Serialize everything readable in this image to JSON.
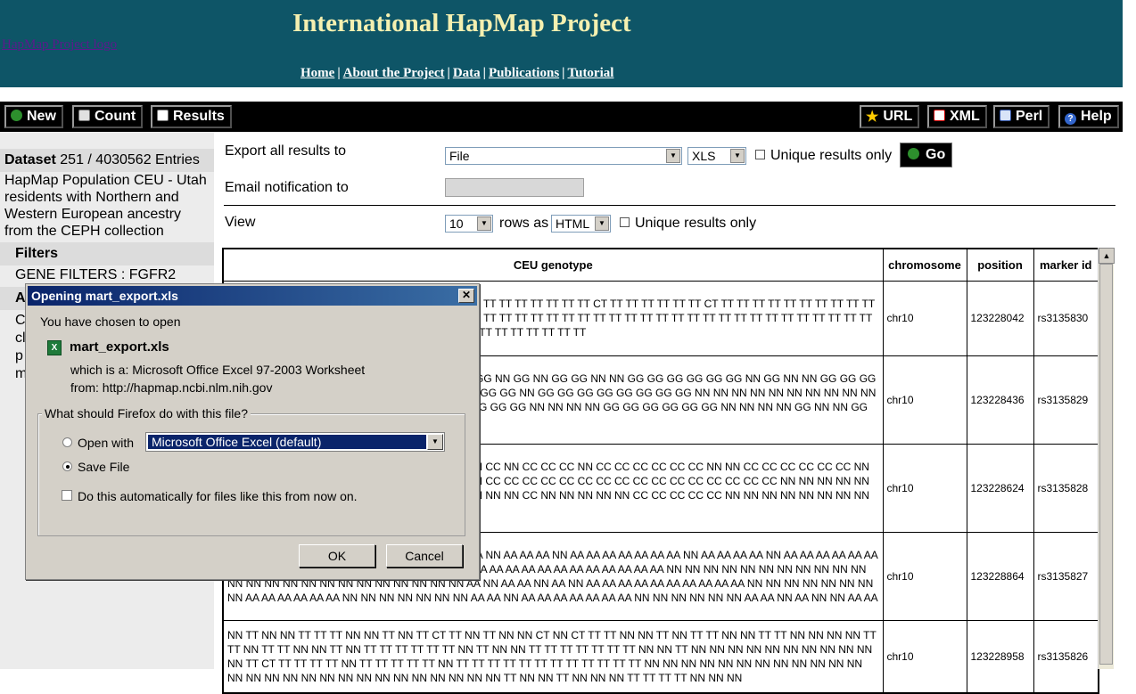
{
  "header": {
    "title": "International HapMap Project",
    "logo_alt": "HapMap Project logo",
    "nav": [
      "Home",
      "About the Project",
      "Data",
      "Publications",
      "Tutorial"
    ]
  },
  "toolbar": {
    "new": "New",
    "count": "Count",
    "results": "Results",
    "url": "URL",
    "xml": "XML",
    "perl": "Perl",
    "help": "Help"
  },
  "sidebar": {
    "dataset_label": "Dataset",
    "dataset_count": "251 / 4030562 Entries",
    "dataset_desc": "HapMap Population CEU - Utah residents with Northern and Western European ancestry from the CEPH collection",
    "filters_label": "Filters",
    "filter_value": "GENE FILTERS : FGFR2",
    "attributes_label": "A",
    "attr_fragments": [
      "C",
      "cl",
      "p",
      "m"
    ]
  },
  "export": {
    "label": "Export  all results to",
    "destination": "File",
    "format": "XLS",
    "unique_label": "Unique results only",
    "go": "Go",
    "email_label": "Email notification to",
    "email_value": ""
  },
  "view": {
    "label": "View",
    "rows": "10",
    "rows_as": "rows as",
    "format": "HTML",
    "unique_label": "Unique results only"
  },
  "table": {
    "headers": [
      "CEU genotype",
      "chromosome",
      "position",
      "marker id"
    ],
    "rows": [
      {
        "genotype": "NN TT NN TT TT TT TT TT TT TT TT TT TT TT TT TT TT TT TT TT TT TT TT CT TT TT TT TT TT TT CT TT TT TT TT TT TT TT TT TT TT TT TT CT TT TT TT TT TT TT CT TT NN TT TT TT TT TT TT TT TT TT TT TT TT TT TT TT TT TT TT TT TT TT TT TT TT TT TT TT TT TT CT TT TT TT TT TT TT TT TT TT TT TT TT TT TT TT TT TT TT TT TT TT TT",
        "chromosome": "chr10",
        "position": "123228042",
        "marker": "rs3135830"
      },
      {
        "genotype": "GG GG NN GG NN NN GG NN GG GG GG NN NN GG NN GG NN GG GG NN NN GG GG GG GG GG GG NN GG NN NN GG GG GG GG NN GG NN GG GG GG GG GG GG GG GG GG GG GG NN GG GG GG GG GG GG GG GG NN NN NN NN NN NN NN NN NN NN NN NN NN NN NN NN NN NN NN GG GG GG NN GG GG GG NN NN NN NN GG GG GG GG GG GG NN NN NN NN GG NN NN GG GG",
        "chromosome": "chr10",
        "position": "123228436",
        "marker": "rs3135829"
      },
      {
        "genotype": "CC NN CC NN NN CC NN CC CC CC NN NN CC NN CC NN CC CC CC NN CC CC CC CC CC CC NN NN CC CC CC CC CC CC NN CC CC CC CC NN CC CC CC CC CC CC CC CC NN CC CC CC CC CC CC CC CC CC CC CC CC CC CC CC CC NN NN NN NN NN NN NN NN NN NN NN NN NN NN NN NN NN NN NN NN NN CC NN NN NN NN NN CC CC CC CC CC NN NN NN NN NN NN NN NN NN CC CC CC",
        "chromosome": "chr10",
        "position": "123228624",
        "marker": "rs3135828"
      },
      {
        "genotype": "AA NN AA NN NN AA NN AA AA AA NN NN AA NN AA NN AA AA AA NN AA AA AA AA AA AA AA NN AA AA AA AA NN AA AA AA AA AA AA AA AA AA AA AA AA AA NN AA AA AA AA NN AA AA AA AA AA AA AA AA AA AA AA AA AA AA NN NN NN NN NN NN NN NN NN NN NN NN NN NN NN NN NN NN NN NN NN NN NN NN AA NN AA AA NN AA NN AA AA AA AA AA AA AA AA AA AA NN NN NN NN NN NN NN NN AA AA AA AA AA AA NN NN NN NN NN NN NN AA AA NN AA AA AA AA AA AA AA NN NN NN NN NN NN AA AA NN AA NN NN AA AA",
        "chromosome": "chr10",
        "position": "123228864",
        "marker": "rs3135827"
      },
      {
        "genotype": "NN TT NN NN TT TT TT NN NN TT NN TT CT TT NN TT NN NN CT NN CT TT TT NN NN TT NN TT TT NN NN TT TT NN NN NN NN TT TT NN TT TT NN NN TT NN TT TT TT TT TT TT NN TT NN NN TT TT TT TT TT TT TT NN NN TT NN NN NN NN NN NN NN NN NN NN NN TT CT TT TT TT TT NN TT TT TT TT TT NN TT TT TT TT TT TT TT TT TT TT TT TT NN NN NN NN NN NN NN NN NN NN NN NN NN NN NN NN NN NN NN NN NN NN NN NN NN NN NN TT NN NN TT NN NN NN TT TT TT TT NN NN NN",
        "chromosome": "chr10",
        "position": "123228958",
        "marker": "rs3135826"
      }
    ]
  },
  "dialog": {
    "title": "Opening mart_export.xls",
    "intro": "You have chosen to open",
    "filename": "mart_export.xls",
    "type_label": "which is a:",
    "type_value": "Microsoft Office Excel 97-2003 Worksheet",
    "from_label": "from:",
    "from_value": "http://hapmap.ncbi.nlm.nih.gov",
    "question": "What should Firefox do with this file?",
    "open_with": "Open with",
    "app": "Microsoft Office Excel (default)",
    "save_file": "Save File",
    "auto_label": "Do this automatically for files like this from now on.",
    "ok": "OK",
    "cancel": "Cancel"
  }
}
